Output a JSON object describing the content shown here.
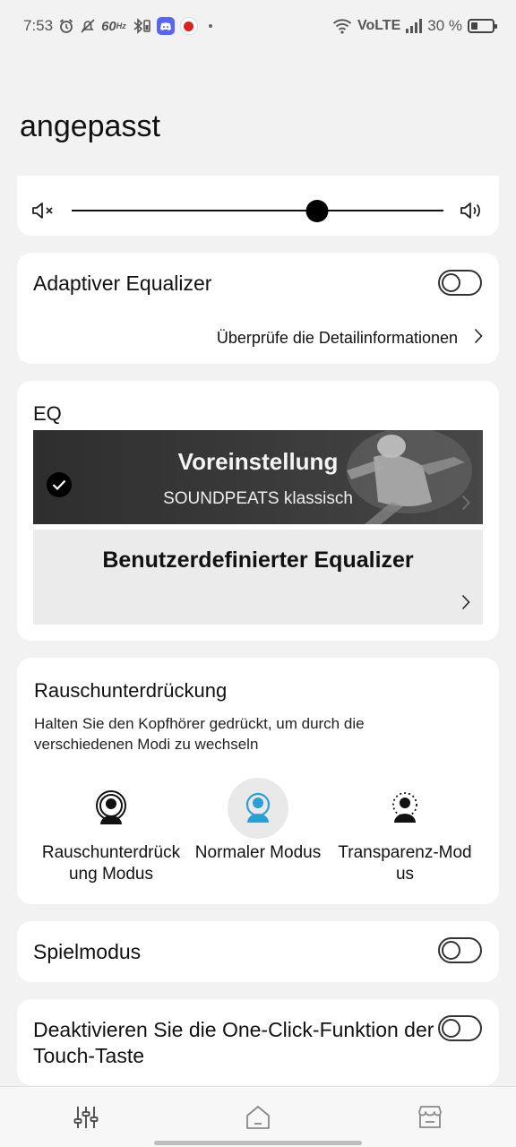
{
  "status_bar": {
    "time": "7:53",
    "net_speed": "60",
    "net_speed_unit": "Hz",
    "carrier": "VoLTE",
    "battery": "30 %",
    "battery_level": 0.3,
    "icons_left": [
      "alarm-icon",
      "dnd-off-icon",
      "bluetooth-icon",
      "discord-icon",
      "youtube-music-icon"
    ],
    "icons_right": [
      "wifi-icon",
      "signal-icon",
      "battery-icon"
    ]
  },
  "page": {
    "title": "angepasst"
  },
  "volume": {
    "level": 0.66,
    "left_icon": "mute-icon",
    "right_icon": "speaker-icon"
  },
  "adaptive_eq": {
    "label": "Adaptiver Equalizer",
    "enabled": false,
    "detail_link": "Überprüfe die Detailinformationen"
  },
  "eq": {
    "label": "EQ",
    "preset": {
      "title": "Voreinstellung",
      "subtitle": "SOUNDPEATS klassisch",
      "selected": true
    },
    "custom": {
      "title": "Benutzerdefinierter Equalizer"
    }
  },
  "noise": {
    "title": "Rauschunterdrückung",
    "hint": "Halten Sie den Kopfhörer gedrückt, um durch die verschiedenen Modi zu wechseln",
    "modes": [
      {
        "label": "Rauschunterdrück ung Modus",
        "icon": "noise-cancelling-icon",
        "active": false
      },
      {
        "label": "Normaler Modus",
        "icon": "normal-mode-icon",
        "active": true
      },
      {
        "label": "Transparenz-Mod us",
        "icon": "transparency-icon",
        "active": false
      }
    ],
    "active_color": "#2a9fd6"
  },
  "game_mode": {
    "label": "Spielmodus",
    "enabled": false
  },
  "one_click": {
    "label": "Deaktivieren Sie die One-Click-Funktion der Touch-Taste",
    "enabled": false
  },
  "bottom_nav": {
    "items": [
      "equalizer-icon",
      "home-icon",
      "store-icon"
    ]
  }
}
